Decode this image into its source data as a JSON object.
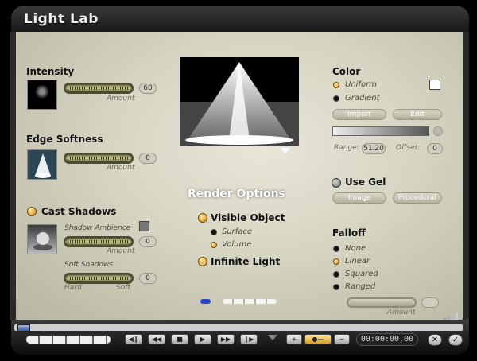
{
  "app": {
    "title": "Light  Lab"
  },
  "intensity": {
    "title": "Intensity",
    "amount_label": "Amount",
    "value": "60"
  },
  "edge": {
    "title": "Edge Softness",
    "amount_label": "Amount",
    "value": "0"
  },
  "shadows": {
    "title": "Cast Shadows",
    "ambience_label": "Shadow Ambience",
    "amount_label": "Amount",
    "ambience_value": "0",
    "soft_label": "Soft Shadows",
    "soft_value": "0",
    "hard_label": "Hard",
    "soft_end_label": "Soft"
  },
  "render": {
    "title": "Render Options",
    "visible_object": "Visible Object",
    "surface": "Surface",
    "volume": "Volume",
    "infinite_light": "Infinite Light"
  },
  "color": {
    "title": "Color",
    "uniform": "Uniform",
    "gradient": "Gradient",
    "import": "Import",
    "edit": "Edit",
    "range_label": "Range:",
    "range_value": "51.20",
    "offset_label": "Offset:",
    "offset_value": "0"
  },
  "gel": {
    "title": "Use Gel",
    "image": "Image",
    "procedural": "Procedural"
  },
  "falloff": {
    "title": "Falloff",
    "none": "None",
    "linear": "Linear",
    "squared": "Squared",
    "ranged": "Ranged",
    "amount_label": "Amount"
  },
  "transport": {
    "timecode": "00:00:00.00"
  },
  "colors": {
    "accent": "#d88a10",
    "panel": "#d6d4c2",
    "frame": "#1a1a1a"
  }
}
